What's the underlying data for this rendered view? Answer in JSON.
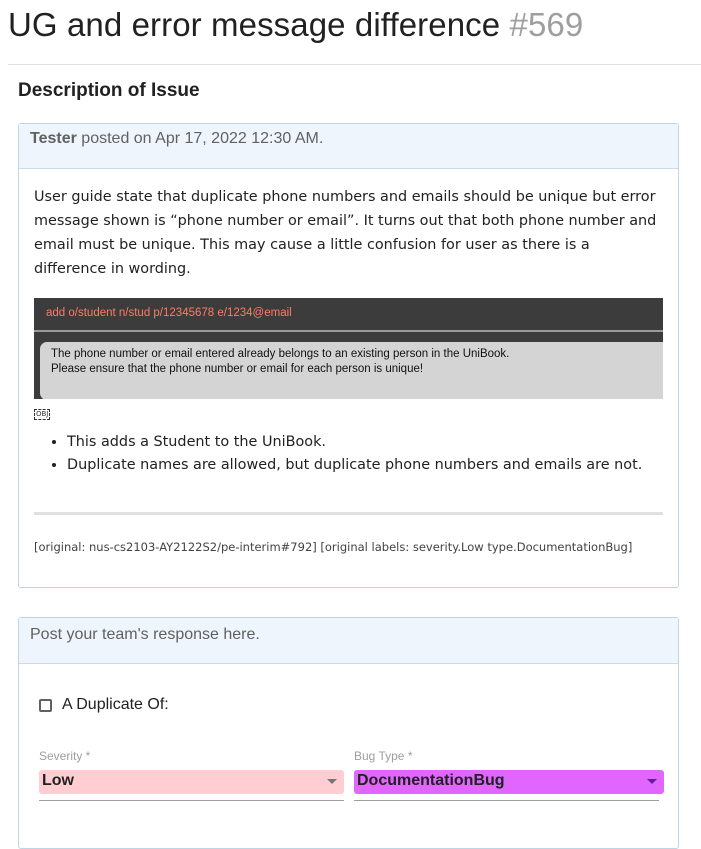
{
  "issue": {
    "title": "UG and error message difference",
    "number": "#569"
  },
  "section_title": "Description of Issue",
  "post": {
    "author": "Tester",
    "posted_text": "posted on Apr 17, 2022 12:30 AM.",
    "body": "User guide state that duplicate phone numbers and emails should be unique but error message shown is “phone number or email”. It turns out that both phone number and email must be unique. This may cause a little confusion for user as there is a difference in wording.",
    "screenshot": {
      "command": "add o/student n/stud p/12345678 e/1234@email",
      "message_line1": "The phone number or email entered already belongs to an existing person in the UniBook.",
      "message_line2": "Please ensure that the phone number or email for each person is unique!"
    },
    "obj_label": "OBJ",
    "bullets": [
      "This adds a Student to the UniBook.",
      "Duplicate names are allowed, but duplicate phone numbers and emails are not."
    ],
    "original_ref": "[original: nus-cs2103-AY2122S2/pe-interim#792] [original labels: severity.Low type.DocumentationBug]"
  },
  "response": {
    "header": "Post your team's response here.",
    "duplicate_label": "A Duplicate Of:",
    "severity_label": "Severity *",
    "severity_value": "Low",
    "bugtype_label": "Bug Type *",
    "bugtype_value": "DocumentationBug"
  },
  "colors": {
    "severity_bg": "#ffcdd2",
    "bugtype_bg": "#e066ff",
    "header_bg": "#eef5fc",
    "card_border": "#bcd6e6"
  }
}
